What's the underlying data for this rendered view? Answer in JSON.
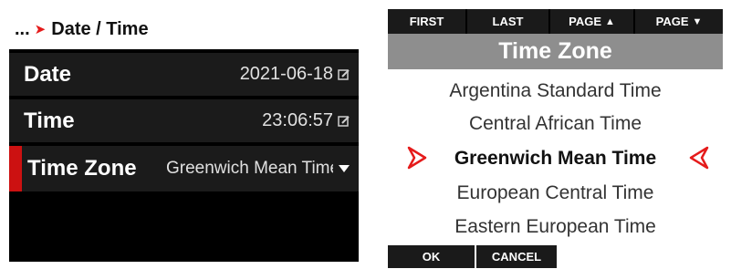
{
  "left_panel": {
    "breadcrumb": {
      "ellipsis": "...",
      "separator_glyph": "➤",
      "current": "Date / Time"
    },
    "rows": {
      "date": {
        "label": "Date",
        "value": "2021-06-18",
        "icon": "edit-icon"
      },
      "time": {
        "label": "Time",
        "value": "23:06:57",
        "icon": "edit-icon"
      },
      "timezone": {
        "label": "Time Zone",
        "value": "Greenwich Mean Time",
        "icon": "chevron-down-icon",
        "selected": true
      }
    }
  },
  "right_panel": {
    "nav": {
      "first": "FIRST",
      "last": "LAST",
      "page_up": "PAGE",
      "page_down": "PAGE"
    },
    "title": "Time Zone",
    "timezones": [
      "Argentina Standard Time",
      "Central African Time",
      "Greenwich Mean Time",
      "European Central Time",
      "Eastern European Time"
    ],
    "selected_index": 2,
    "buttons": {
      "ok": "OK",
      "cancel": "CANCEL"
    }
  },
  "colors": {
    "accent_red": "#cc1111",
    "row_background": "#1b1b1b",
    "title_gray": "#8e8e8e"
  }
}
